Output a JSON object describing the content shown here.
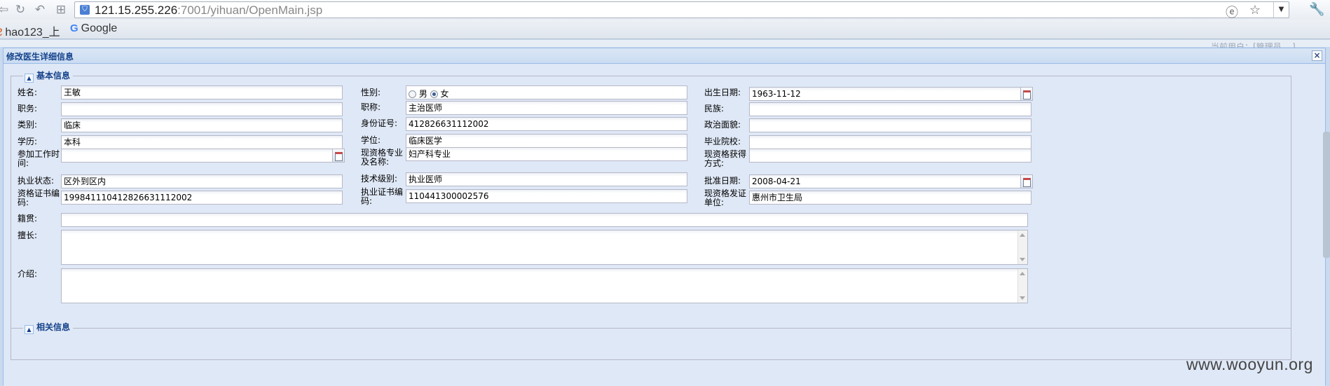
{
  "browser": {
    "url_host": "121.15.255.226",
    "url_rest": ":7001/yihuan/OpenMain.jsp",
    "bookmarks": [
      "hao123_上",
      "Google"
    ],
    "background_hint": "当前用户：[管理员 ...]"
  },
  "dialog": {
    "title": "修改医生详细信息",
    "close": "×",
    "section_basic": "基本信息",
    "section_related": "相关信息"
  },
  "form": {
    "name_label": "姓名:",
    "name": "王敏",
    "gender_label": "性别:",
    "gender_male": "男",
    "gender_female": "女",
    "gender_selected": "女",
    "birth_label": "出生日期:",
    "birth": "1963-11-12",
    "duty_label": "职务:",
    "duty": "",
    "title_label": "职称:",
    "title": "主治医师",
    "nation_label": "民族:",
    "nation": "",
    "category_label": "类别:",
    "category": "临床",
    "idno_label": "身份证号:",
    "idno": "412826631112002",
    "political_label": "政治面貌:",
    "political": "",
    "education_label": "学历:",
    "education": "本科",
    "degree_label": "学位:",
    "degree": "临床医学",
    "school_label": "毕业院校:",
    "school": "",
    "workstart_label_1": "参加工作时",
    "workstart_label_2": "间:",
    "workstart": "",
    "qualspec_label_1": "现资格专业",
    "qualspec_label_2": "及名称:",
    "qualspec": "妇产科专业",
    "qualget_label_1": "现资格获得",
    "qualget_label_2": "方式:",
    "qualget": "",
    "practice_label": "执业状态:",
    "practice": "区外到区内",
    "techlevel_label": "技术级别:",
    "techlevel": "执业医师",
    "approve_label": "批准日期:",
    "approve": "2008-04-21",
    "qualcert_label_1": "资格证书编",
    "qualcert_label_2": "码:",
    "qualcert": "199841110412826631112002",
    "practicecert_label_1": "执业证书编",
    "practicecert_label_2": "码:",
    "practicecert": "110441300002576",
    "issuer_label_1": "现资格发证",
    "issuer_label_2": "单位:",
    "issuer": "惠州市卫生局",
    "native_label": "籍贯:",
    "native": "",
    "specialty_label": "擅长:",
    "specialty": "",
    "intro_label": "介绍:",
    "intro": ""
  },
  "watermark": "www.wooyun.org"
}
